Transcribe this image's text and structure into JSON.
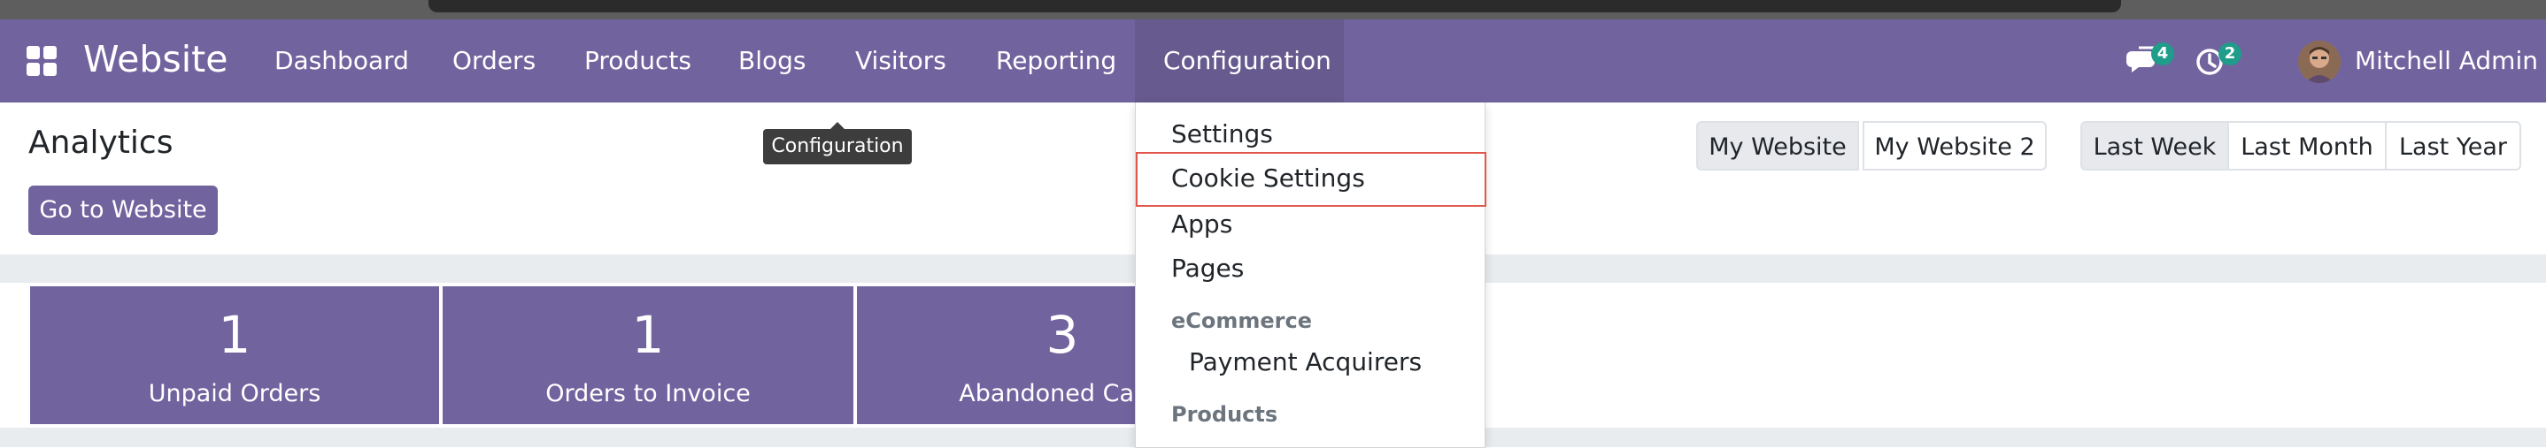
{
  "app": {
    "name": "Website"
  },
  "nav": {
    "items": [
      {
        "label": "Dashboard"
      },
      {
        "label": "Orders"
      },
      {
        "label": "Products"
      },
      {
        "label": "Blogs"
      },
      {
        "label": "Visitors"
      },
      {
        "label": "Reporting"
      },
      {
        "label": "Configuration"
      }
    ],
    "messages_count": "4",
    "activities_count": "2",
    "user_name": "Mitchell Admin"
  },
  "page": {
    "title": "Analytics",
    "go_button": "Go to Website",
    "tooltip": "Configuration"
  },
  "website_filter": [
    "My Website",
    "My Website 2"
  ],
  "period_filter": [
    "Last Week",
    "Last Month",
    "Last Year"
  ],
  "stats": [
    {
      "value": "1",
      "label": "Unpaid Orders"
    },
    {
      "value": "1",
      "label": "Orders to Invoice"
    },
    {
      "value": "3",
      "label": "Abandoned Carts"
    }
  ],
  "config_menu": {
    "items": [
      "Settings",
      "Cookie Settings",
      "Apps",
      "Pages"
    ],
    "ecommerce_header": "eCommerce",
    "ecommerce_items": [
      "Payment Acquirers"
    ],
    "products_header": "Products"
  },
  "colors": {
    "brand": "#71639e",
    "badge": "#1f9c8a",
    "highlight": "#e2574c"
  }
}
